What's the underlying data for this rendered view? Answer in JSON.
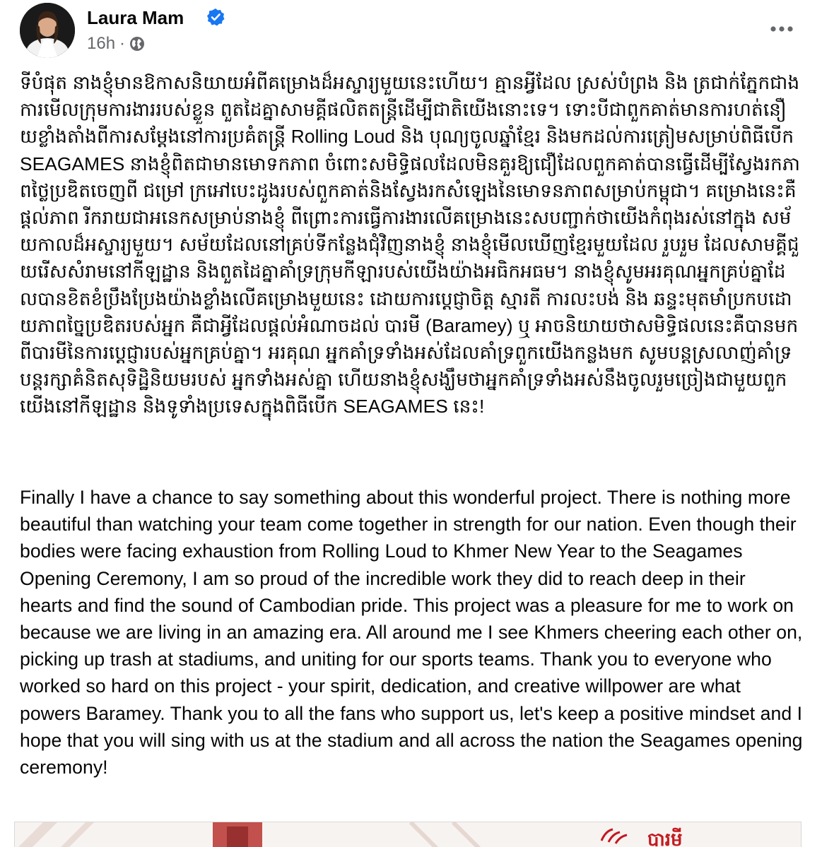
{
  "author": {
    "name": "Laura Mam",
    "verified": true,
    "time": "16h",
    "separator": "·",
    "privacy_icon": "globe-icon"
  },
  "menu": {
    "icon": "more-horizontal-icon"
  },
  "post": {
    "khmer_text": "ទីបំផុត នាងខ្ញុំមានឱកាសនិយាយអំពីគម្រោងដ៏អស្ចារ្យមួយនេះហើយ។ គ្មានអ្វីដែល ស្រស់បំព្រង និង ត្រជាក់ភ្នែកជាងការមើលក្រុមការងាររបស់ខ្លួន ពួតដៃគ្នាសាមគ្គីផលិតតន្ត្រីដើម្បីជាតិយើងនោះទេ។ ទោះបីជាពួកគាត់មានការហត់នឿយខ្លាំងតាំងពីការសម្ដែងនៅការប្រគំតន្ត្រី Rolling Loud និង បុណ្យចូលឆ្នាំខ្មែរ និងមកដល់ការត្រៀមសម្រាប់ពិធីបើក SEAGAMES នាងខ្ញុំពិតជាមានមោទកភាព ចំពោះសមិទ្ធិផលដែលមិនគួរឱ្យជឿដែលពួកគាត់បានធ្វើដើម្បីស្វែងរកភាពថ្លៃប្រឌិតចេញពី ជម្រៅ ក្រអៅបេះដូងរបស់ពួកគាត់និងស្វែងរកសំឡេងនៃមោទនភាពសម្រាប់កម្ពុជា។ គម្រោងនេះគឺផ្ដល់ភាព រីករាយជាអនេកសម្រាប់នាងខ្ញុំ ពីព្រោះការធ្វើការងារលើគម្រោងនេះសបញ្ជាក់ថាយើងកំពុងរស់នៅក្នុង សម័យកាលដ៏អស្ចារ្យមួយ។ សម័យដែលនៅគ្រប់ទីកន្លែងជុំវិញនាងខ្ញុំ នាងខ្ញុំមើលឃើញខ្មែរមួយដែល រួបរួម ដែលសាមគ្គីជួយរើសសំរាមនៅកីឡដ្ឋាន និងពួតដៃគ្នាគាំទ្រក្រុមកីឡារបស់យើងយ៉ាងអធិកអធម។ នាងខ្ញុំសូមអរគុណអ្នកគ្រប់គ្នាដែលបានខិតខំប្រឹងប្រែងយ៉ាងខ្លាំងលើគម្រោងមួយនេះ ដោយការប្ដេជ្ញាចិត្ត ស្មារតី ការលះបង់ និង ឆន្ទះមុតមាំប្រកបដោយភាពច្នៃប្រឌិតរបស់អ្នក គឺជាអ្វីដែលផ្ដល់អំណាចដល់ បារមី (Baramey) ឬ អាចនិយាយថាសមិទ្ធិផលនេះគឺបានមកពីបារមីនៃការប្ដេជ្ញារបស់អ្នកគ្រប់គ្នា។ អរគុណ អ្នកគាំទ្រទាំងអស់ដែលគាំទ្រពួកយើងកន្លងមក សូមបន្តស្រលាញ់គាំទ្រ បន្តរក្សាគំនិតសុទិដ្ឋិនិយមរបស់ អ្នកទាំងអស់គ្នា ហើយនាងខ្ញុំសង្ឃឹមថាអ្នកគាំទ្រទាំងអស់នឹងចូលរួមច្រៀងជាមួយពួកយើងនៅកីឡដ្ឋាន និងទូទាំងប្រទេសក្នុងពិធីបើក SEAGAMES នេះ!",
    "english_text": "Finally I have a chance to say something about this wonderful project. There is nothing more beautiful than watching your team come together in strength for our nation. Even though their bodies were facing exhaustion from Rolling Loud to Khmer New Year to the Seagames Opening Ceremony, I am so proud of the incredible work they did to reach deep in their hearts and find the sound of Cambodian pride. This project was a pleasure for me to work on because we are living in an amazing era. All around me I see Khmers cheering each other on, picking up trash at stadiums, and uniting for our sports teams. Thank you to everyone who worked so hard on this project - your spirit, dedication, and creative willpower are what powers Baramey. Thank you to all the fans who support us, let's keep a positive mindset and I hope that you will sing with us at the stadium and all across the nation the Seagames opening ceremony!"
  },
  "attachment": {
    "logo_text": "បារមី",
    "colors": {
      "logo_red": "#c3191f",
      "background": "#f7f3f1"
    }
  },
  "colors": {
    "text": "#050505",
    "secondary": "#65676b",
    "verified_blue": "#1877f2"
  }
}
